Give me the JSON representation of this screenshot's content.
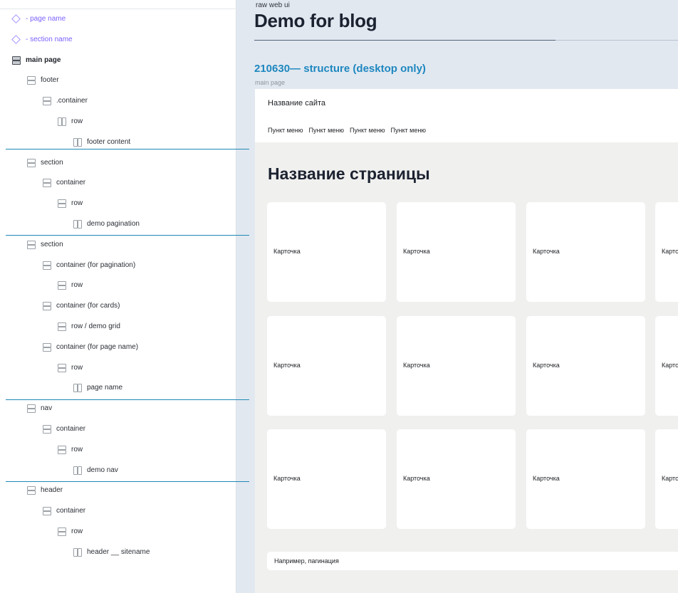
{
  "layers": {
    "items": [
      {
        "label": "- page name"
      },
      {
        "label": "- section name"
      },
      {
        "label": "main page"
      },
      {
        "label": "footer"
      },
      {
        "label": ".container"
      },
      {
        "label": "row"
      },
      {
        "label": "footer content"
      },
      {
        "label": "section"
      },
      {
        "label": "container"
      },
      {
        "label": "row"
      },
      {
        "label": "demo pagination"
      },
      {
        "label": "section"
      },
      {
        "label": "container (for pagination)"
      },
      {
        "label": "row"
      },
      {
        "label": "container (for cards)"
      },
      {
        "label": "row / demo grid"
      },
      {
        "label": "container (for page name)"
      },
      {
        "label": "row"
      },
      {
        "label": "page name"
      },
      {
        "label": "nav"
      },
      {
        "label": "container"
      },
      {
        "label": "row"
      },
      {
        "label": "demo nav"
      },
      {
        "label": "header"
      },
      {
        "label": "container"
      },
      {
        "label": "row"
      },
      {
        "label": "header __ sitename"
      }
    ]
  },
  "canvas": {
    "caption": "raw web ui",
    "title": "Demo for blog",
    "frame_title": "210630— structure (desktop only)",
    "frame_label": "main page"
  },
  "site": {
    "name": "Название сайта",
    "nav": [
      "Пункт меню",
      "Пункт меню",
      "Пункт меню",
      "Пункт меню"
    ],
    "page_name": "Название страницы",
    "cards": [
      "Карточка",
      "Карточка",
      "Карточка",
      "Карточка",
      "Карточка",
      "Карточка",
      "Карточка",
      "Карточка",
      "Карточка",
      "Карточка",
      "Карточка",
      "Карточка"
    ],
    "pagination": "Например, пагинация"
  },
  "colors": {
    "component": "#7b61ff",
    "separator": "#1e88b5",
    "frame_title": "#1d87bf",
    "canvas_bg": "#e2e8f0",
    "frame_bg": "#f0f0ef"
  }
}
